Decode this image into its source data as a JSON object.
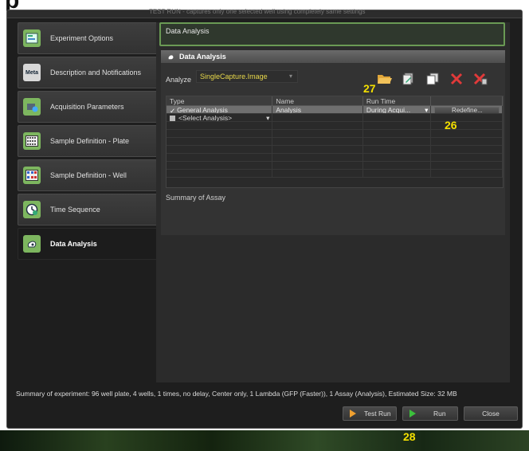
{
  "app": {
    "top_hint": "TEST RUN - captures only one selected well using completely same settings"
  },
  "sidebar": {
    "items": [
      {
        "label": "Experiment Options",
        "icon": "experiment-options-icon"
      },
      {
        "label": "Description and Notifications",
        "icon": "meta-icon",
        "icon_text": "Meta"
      },
      {
        "label": "Acquisition Parameters",
        "icon": "camera-gear-icon"
      },
      {
        "label": "Sample Definition - Plate",
        "icon": "plate-icon"
      },
      {
        "label": "Sample Definition - Well",
        "icon": "well-grid-icon"
      },
      {
        "label": "Time Sequence",
        "icon": "clock-icon"
      },
      {
        "label": "Data Analysis",
        "icon": "analysis-icon",
        "active": true
      }
    ]
  },
  "main": {
    "section_field": "Data Analysis",
    "panel_title": "Data Analysis",
    "analyze_label": "Analyze",
    "analyze_value": "SingleCapture.Image",
    "columns": [
      "Type",
      "Name",
      "Run Time"
    ],
    "rows": [
      {
        "checked": true,
        "type": "General Analysis",
        "name": "Analysis",
        "run_time": "During Acqui...",
        "action": "Redefine..."
      },
      {
        "checked": false,
        "type": "<Select Analysis>",
        "name": "",
        "run_time": "",
        "action": ""
      }
    ],
    "summary_of_assay": "Summary of Assay"
  },
  "callouts": {
    "open": "27",
    "redefine": "26",
    "run": "28"
  },
  "footer": {
    "summary": "Summary of experiment: 96 well plate, 4 wells, 1 times, no delay, Center only, 1 Lambda (GFP (Faster)), 1 Assay (Analysis), Estimated Size: 32 MB",
    "test_run": "Test Run",
    "run": "Run",
    "close": "Close"
  },
  "colors": {
    "accent_green": "#6a9a54",
    "callout_yellow": "#f4e000",
    "analyze_value": "#e8d84a"
  }
}
